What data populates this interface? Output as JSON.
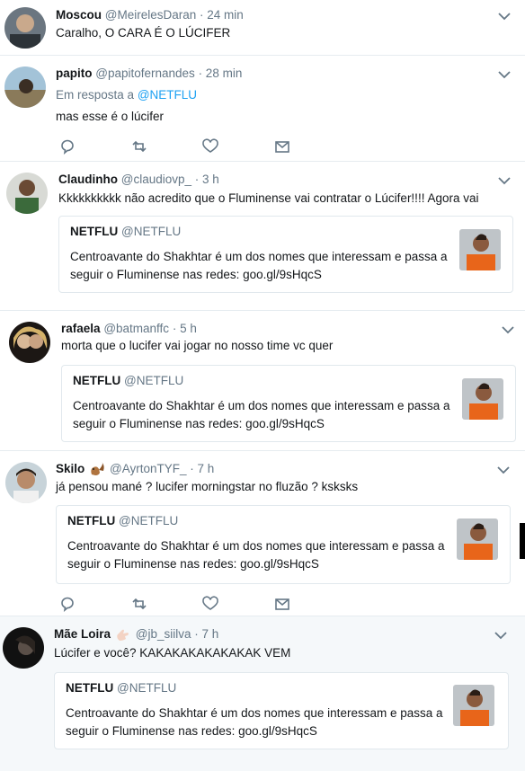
{
  "tweets": [
    {
      "name": "Moscou",
      "handle": "@MeirelesDaran",
      "time": "· 24 min",
      "text": "Caralho, O CARA É O LÚCIFER"
    },
    {
      "name": "papito",
      "handle": "@papitofernandes",
      "time": "· 28 min",
      "reply_prefix": "Em resposta a",
      "reply_to": "@NETFLU",
      "text": "mas esse é o lúcifer"
    },
    {
      "name": "Claudinho",
      "handle": "@claudiovp_",
      "time": "· 3 h",
      "text": "Kkkkkkkkkk não acredito que o Fluminense vai contratar o Lúcifer!!!! Agora vai"
    },
    {
      "name": "rafaela",
      "handle": "@batmanffc",
      "time": "· 5 h",
      "text": "morta que o lucifer vai jogar no nosso time vc quer"
    },
    {
      "name": "Skilo",
      "handle": "@AyrtonTYF_",
      "time": "· 7 h",
      "text": "já pensou mané ? lucifer morningstar no fluzão ? ksksks"
    },
    {
      "name": "Mãe Loira",
      "handle": "@jb_siilva",
      "time": "· 7 h",
      "text": "Lúcifer e você? KAKAKAKAKAKAKAK VEM"
    }
  ],
  "quote": {
    "name": "NETFLU",
    "handle": "@NETFLU",
    "text": "Centroavante do Shakhtar é um dos nomes que interessam e passa a seguir o Fluminense nas redes: goo.gl/9sHqcS"
  },
  "icons": {
    "reply": "reply-icon",
    "retweet": "retweet-icon",
    "like": "heart-icon",
    "dm": "envelope-icon",
    "more": "chevron-down-icon"
  },
  "colors": {
    "link": "#1da1f2",
    "secondary": "#657786",
    "highlight_bg": "#f5f8fa"
  }
}
